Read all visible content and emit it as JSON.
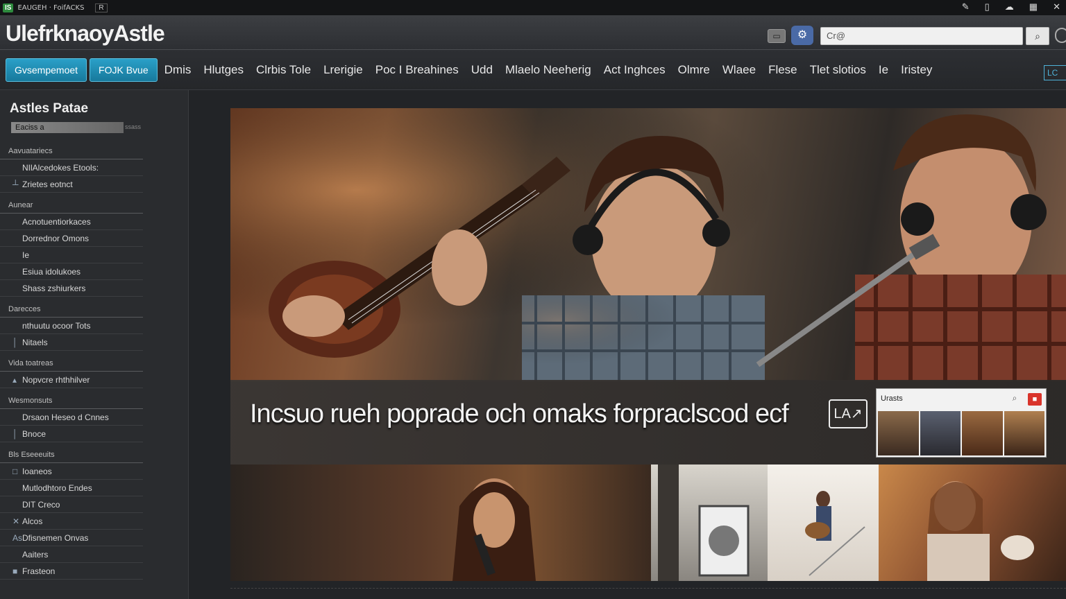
{
  "topbar": {
    "badge": "IS",
    "tab_text": "EAUGEH · FoifACKS",
    "tab_box": "R"
  },
  "header": {
    "logo": "UlefrknaoyAstle",
    "search_value": "Cr@",
    "search_button": "⌕"
  },
  "nav": {
    "buttons": [
      "Gvsempemoet",
      "FOJK Bvue"
    ],
    "links": [
      "Dmis",
      "Hlutges",
      "Clrbis Tole",
      "Lrerigie",
      "Poc I Breahines",
      "Udd",
      "Mlaelo Neeherig",
      "Act Inghces",
      "Olmre",
      "Wlaee",
      "Flese",
      "Tlet slotios",
      "Ie",
      "Iristey"
    ],
    "end_label": "LC"
  },
  "sidebar": {
    "title": "Astles Patae",
    "filter_value": "Eaciss a",
    "filter_tail": "ssass",
    "items": [
      {
        "label": "Aavuatariecs",
        "type": "section"
      },
      {
        "label": "NIlAlcedokes Etools:",
        "mark": ""
      },
      {
        "label": "Zrietes eotnct",
        "mark": "┴"
      },
      {
        "label": "Aunear",
        "type": "section"
      },
      {
        "label": "Acnotuentiorkaces",
        "mark": ""
      },
      {
        "label": "Dorrednor Omons",
        "mark": ""
      },
      {
        "label": "Ie",
        "mark": ""
      },
      {
        "label": "Esiua idolukoes",
        "mark": ""
      },
      {
        "label": "Shass zshiurkers",
        "mark": ""
      },
      {
        "label": "Darecces",
        "type": "section"
      },
      {
        "label": "nthuutu ocoor Tots",
        "mark": ""
      },
      {
        "label": "Nitaels",
        "mark": "│"
      },
      {
        "label": "Vida toatreas",
        "type": "section"
      },
      {
        "label": "Nopvcre rhthhilver",
        "mark": "▴"
      },
      {
        "label": "Wesmonsuts",
        "type": "section"
      },
      {
        "label": "Drsaon Heseo d Cnnes",
        "mark": ""
      },
      {
        "label": "Bnoce",
        "mark": "│"
      },
      {
        "label": "Bls Eseeeuits",
        "type": "section"
      },
      {
        "label": "Ioaneos",
        "mark": "□"
      },
      {
        "label": "Mutlodhtoro Endes",
        "mark": ""
      },
      {
        "label": "DIT Creco",
        "mark": ""
      },
      {
        "label": "Alcos",
        "mark": "✕"
      },
      {
        "label": "Dfisnemen Onvas",
        "mark": "As"
      },
      {
        "label": "Aaiters",
        "mark": ""
      },
      {
        "label": "Frasteon",
        "mark": "■"
      }
    ]
  },
  "hero": {
    "headline": "Incsuo rueh poprade och omaks forpraclscod ecf",
    "headline_icon": "LA↗",
    "popup_title": "Urasts",
    "popup_close": "■"
  },
  "colors": {
    "accent_button": "#17799c",
    "popup_close": "#d9342b",
    "page_bg": "#222427"
  }
}
